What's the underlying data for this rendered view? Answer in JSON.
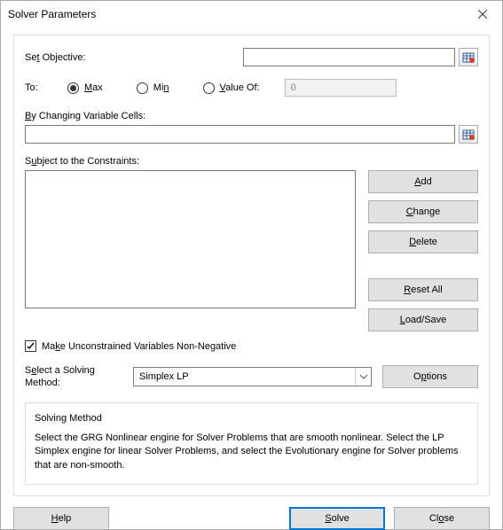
{
  "title": "Solver Parameters",
  "labels": {
    "set_objective": "Set Objective:",
    "to": "To:",
    "by_changing": "By Changing Variable Cells:",
    "subject_to": "Subject to the Constraints:",
    "make_unconstrained": "Make Unconstrained Variables Non-Negative",
    "select_method": "Select a Solving Method:"
  },
  "objective": {
    "value": ""
  },
  "to_options": {
    "max": "Max",
    "min": "Min",
    "valueof": "Value Of:",
    "selected": "max",
    "value_of_input": "0"
  },
  "by_changing": {
    "value": ""
  },
  "constraints": {
    "items": []
  },
  "side_buttons": {
    "add": "Add",
    "change": "Change",
    "delete": "Delete",
    "reset_all": "Reset All",
    "load_save": "Load/Save"
  },
  "checkbox": {
    "checked": true
  },
  "method": {
    "selected": "Simplex LP",
    "options_button": "Options"
  },
  "info": {
    "heading": "Solving Method",
    "body": "Select the GRG Nonlinear engine for Solver Problems that are smooth nonlinear. Select the LP Simplex engine for linear Solver Problems, and select the Evolutionary engine for Solver problems that are non-smooth."
  },
  "footer": {
    "help": "Help",
    "solve": "Solve",
    "close": "Close"
  }
}
